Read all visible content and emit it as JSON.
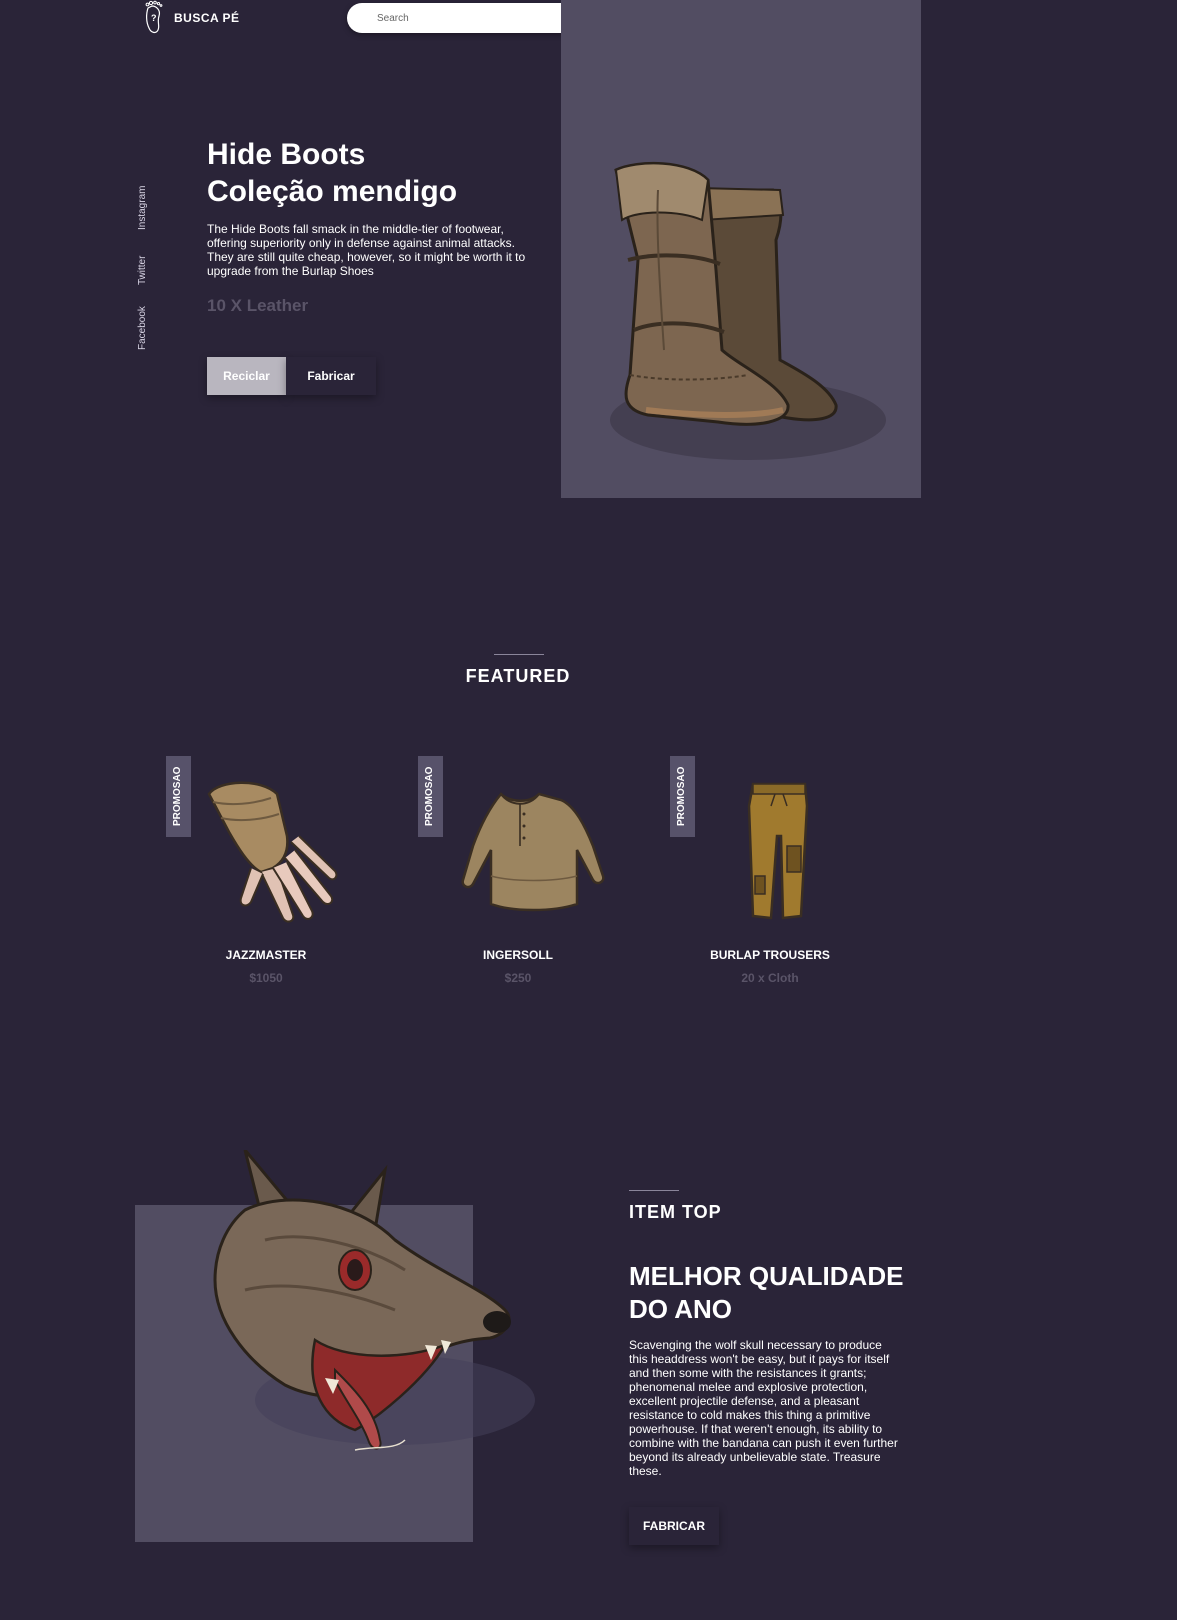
{
  "brand": {
    "name": "BUSCA PÉ"
  },
  "search": {
    "placeholder": "Search",
    "value": ""
  },
  "header_icons": [
    "user-icon",
    "heart-icon",
    "shopping-bag-icon"
  ],
  "social": [
    "Instagram",
    "Twitter",
    "Facebook"
  ],
  "hero": {
    "title_line1": "Hide Boots",
    "title_line2": "Coleção mendigo",
    "description": "The Hide Boots fall smack in the middle-tier of footwear, offering superiority only in defense against animal attacks. They are still quite cheap, however, so it might be worth it to upgrade from the Burlap Shoes",
    "price": "10 X Leather",
    "btn_recycle": "Reciclar",
    "btn_craft": "Fabricar"
  },
  "featured": {
    "title": "FEATURED",
    "items": [
      {
        "badge": "PROMOSAO",
        "name": "JAZZMASTER",
        "price": "$1050"
      },
      {
        "badge": "PROMOSAO",
        "name": "INGERSOLL",
        "price": "$250"
      },
      {
        "badge": "PROMOSAO",
        "name": "BURLAP TROUSERS",
        "price": "20 x Cloth"
      }
    ]
  },
  "item_top": {
    "label": "ITEM TOP",
    "title": "MELHOR QUALIDADE DO ANO",
    "description": "Scavenging the wolf skull necessary to produce this headdress won't be easy, but it pays for itself and then some with the resistances it grants; phenomenal melee and explosive protection, excellent projectile defense, and a pleasant resistance to cold makes this thing a primitive powerhouse. If that weren't enough, its ability to combine with the bandana can push it even further beyond its already unbelievable state. Treasure these.",
    "btn_craft": "FABRICAR"
  },
  "colors": {
    "background": "#2a2438",
    "panel": "#524d62",
    "muted_text": "#5a5468",
    "badge": "#57526a"
  }
}
